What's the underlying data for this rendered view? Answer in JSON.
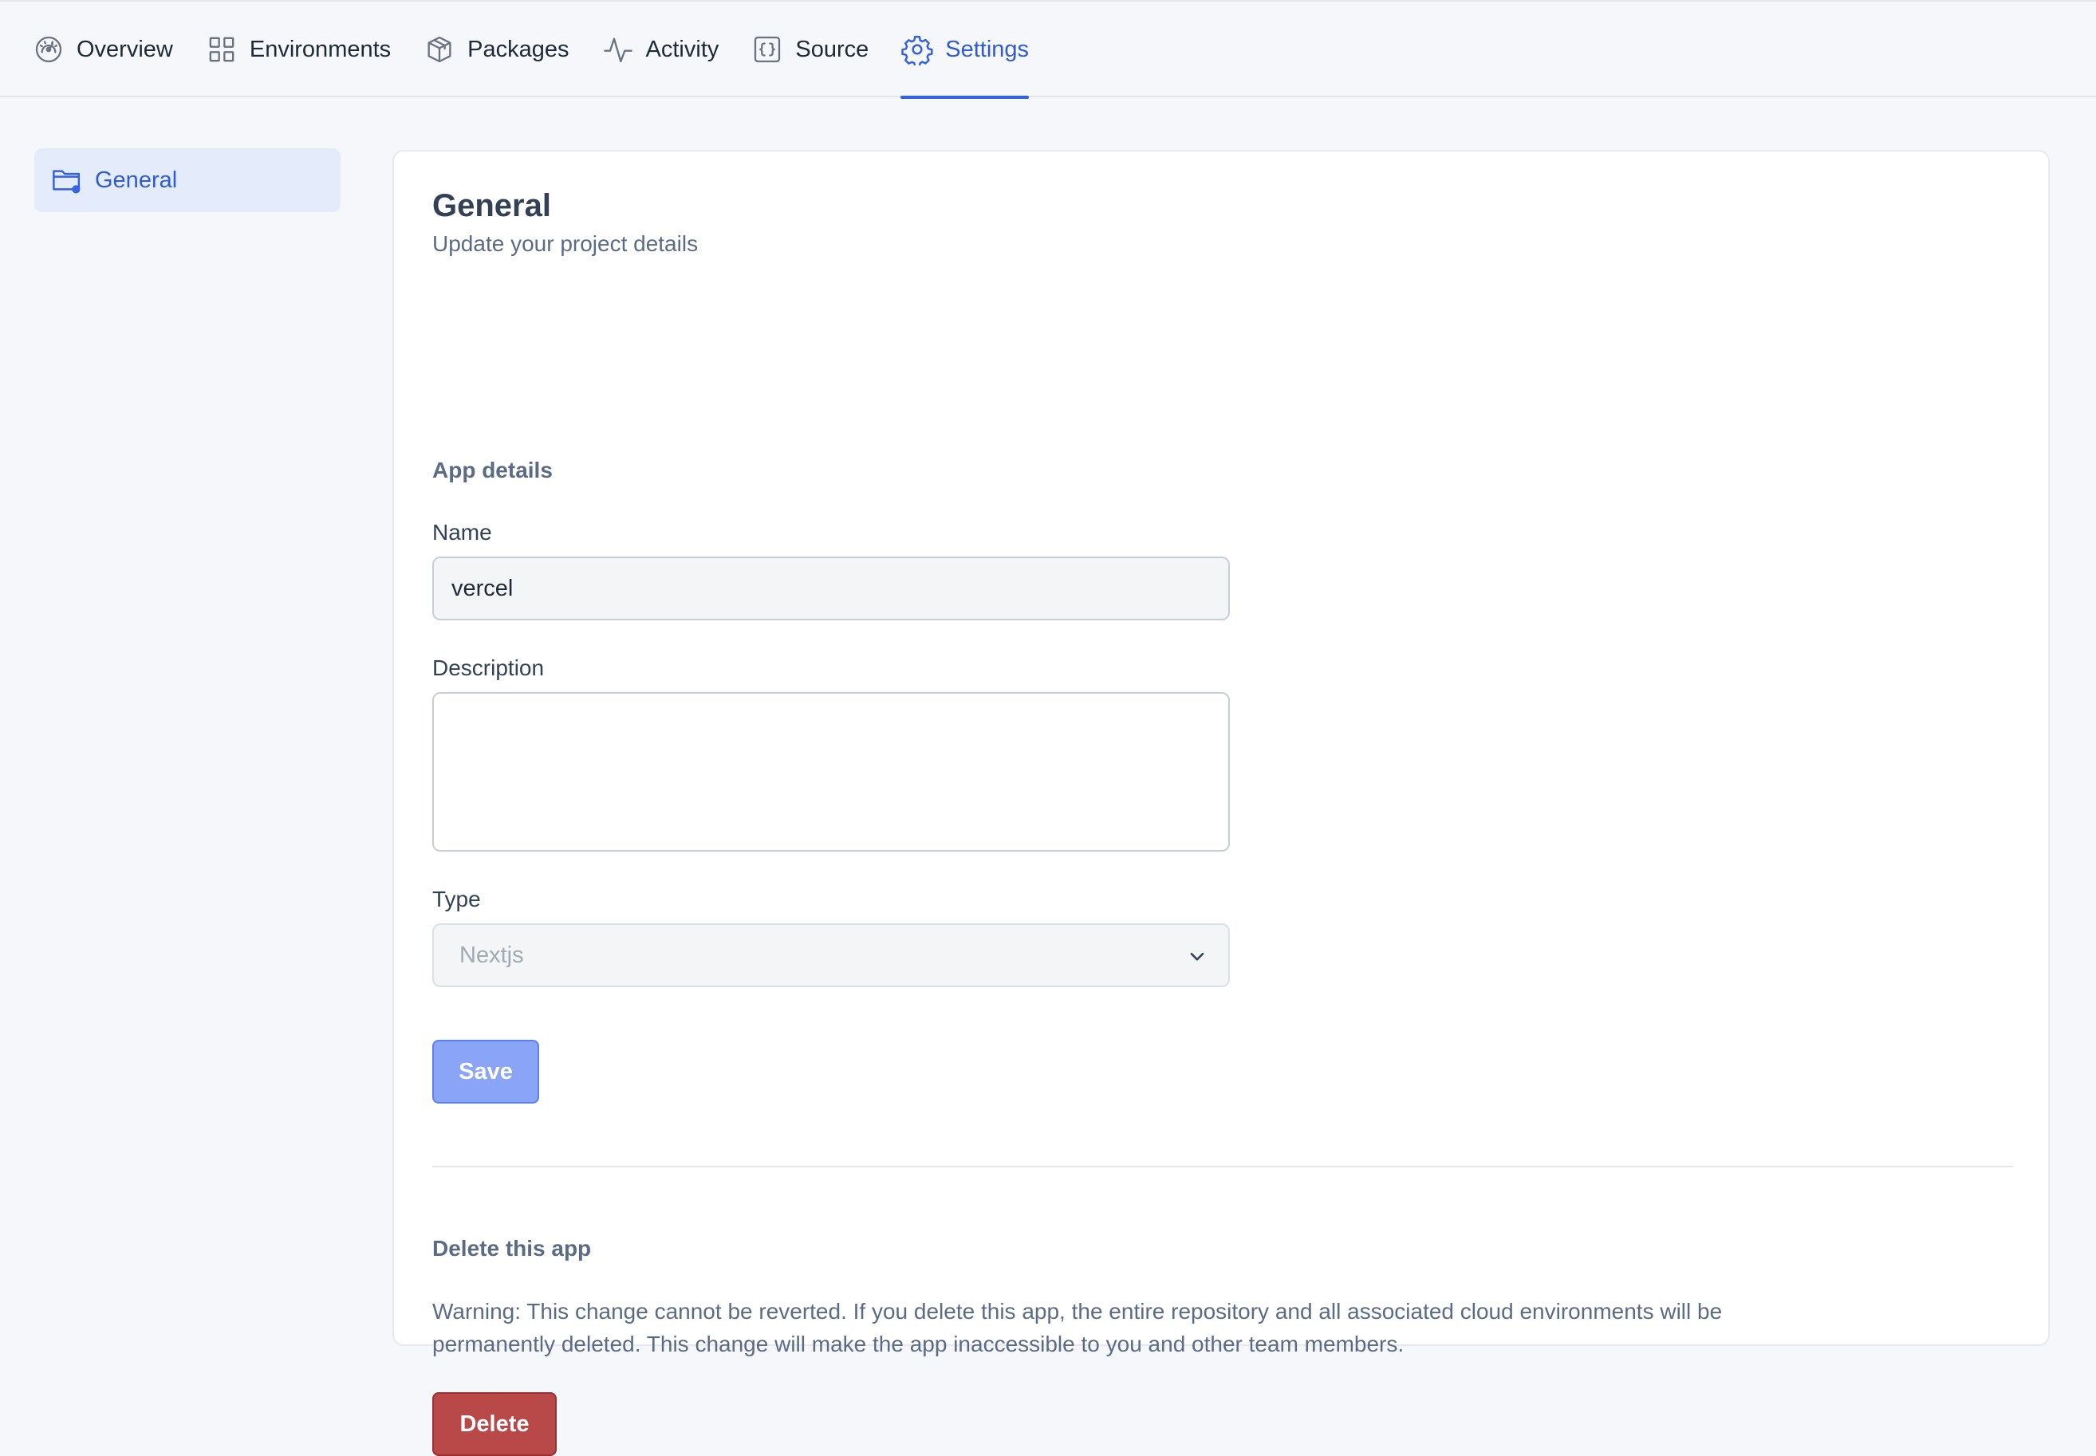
{
  "nav": {
    "tabs": [
      {
        "label": "Overview",
        "icon": "dashboard-icon"
      },
      {
        "label": "Environments",
        "icon": "grid-icon"
      },
      {
        "label": "Packages",
        "icon": "package-icon"
      },
      {
        "label": "Activity",
        "icon": "activity-icon"
      },
      {
        "label": "Source",
        "icon": "code-icon"
      },
      {
        "label": "Settings",
        "icon": "gear-icon",
        "active": true
      }
    ]
  },
  "sidebar": {
    "items": [
      {
        "label": "General",
        "icon": "folder-settings-icon",
        "active": true
      }
    ]
  },
  "general": {
    "title": "General",
    "subtitle": "Update your project details",
    "app_details": {
      "title": "App details",
      "name_label": "Name",
      "name_value": "vercel",
      "description_label": "Description",
      "description_value": "",
      "type_label": "Type",
      "type_value": "Nextjs",
      "save_label": "Save"
    },
    "delete": {
      "title": "Delete this app",
      "warning": "Warning: This change cannot be reverted. If you delete this app, the entire repository and all associated cloud environments will be permanently deleted. This change will make the app inaccessible to you and other team members.",
      "delete_label": "Delete"
    }
  },
  "colors": {
    "accent": "#3461e0",
    "save_button": "#8aa5f5",
    "delete_button": "#b94848",
    "sidebar_active_bg": "#e4ebfb"
  }
}
